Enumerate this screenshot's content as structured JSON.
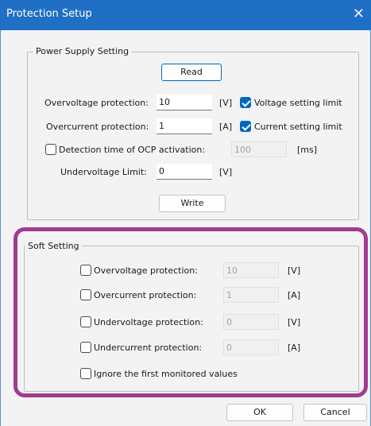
{
  "window": {
    "title": "Protection Setup",
    "close_glyph": "✕"
  },
  "power_supply": {
    "legend": "Power Supply Setting",
    "read_label": "Read",
    "overvoltage": {
      "label": "Overvoltage protection:",
      "value": "10",
      "unit": "[V]",
      "limit_label": "Voltage setting limit",
      "limit_checked": true
    },
    "overcurrent": {
      "label": "Overcurrent protection:",
      "value": "1",
      "unit": "[A]",
      "limit_label": "Current setting limit",
      "limit_checked": true
    },
    "ocp_detection": {
      "label": "Detection time of OCP activation:",
      "value": "100",
      "unit": "[ms]",
      "checked": false
    },
    "undervoltage": {
      "label": "Undervoltage Limit:",
      "value": "0",
      "unit": "[V]"
    },
    "write_label": "Write"
  },
  "soft_setting": {
    "legend": "Soft Setting",
    "overvoltage": {
      "label": "Overvoltage protection:",
      "value": "10",
      "unit": "[V]",
      "checked": false
    },
    "overcurrent": {
      "label": "Overcurrent protection:",
      "value": "1",
      "unit": "[A]",
      "checked": false
    },
    "undervoltage": {
      "label": "Undervoltage protection:",
      "value": "0",
      "unit": "[V]",
      "checked": false
    },
    "undercurrent": {
      "label": "Undercurrent protection:",
      "value": "0",
      "unit": "[A]",
      "checked": false
    },
    "ignore_first": {
      "label": "Ignore the first monitored values",
      "checked": false
    }
  },
  "footer": {
    "ok_label": "OK",
    "cancel_label": "Cancel"
  },
  "colors": {
    "titlebar": "#1f6fc5",
    "accent": "#0067c0",
    "highlight": "#a13c8e",
    "background": "#f3f3f3"
  }
}
